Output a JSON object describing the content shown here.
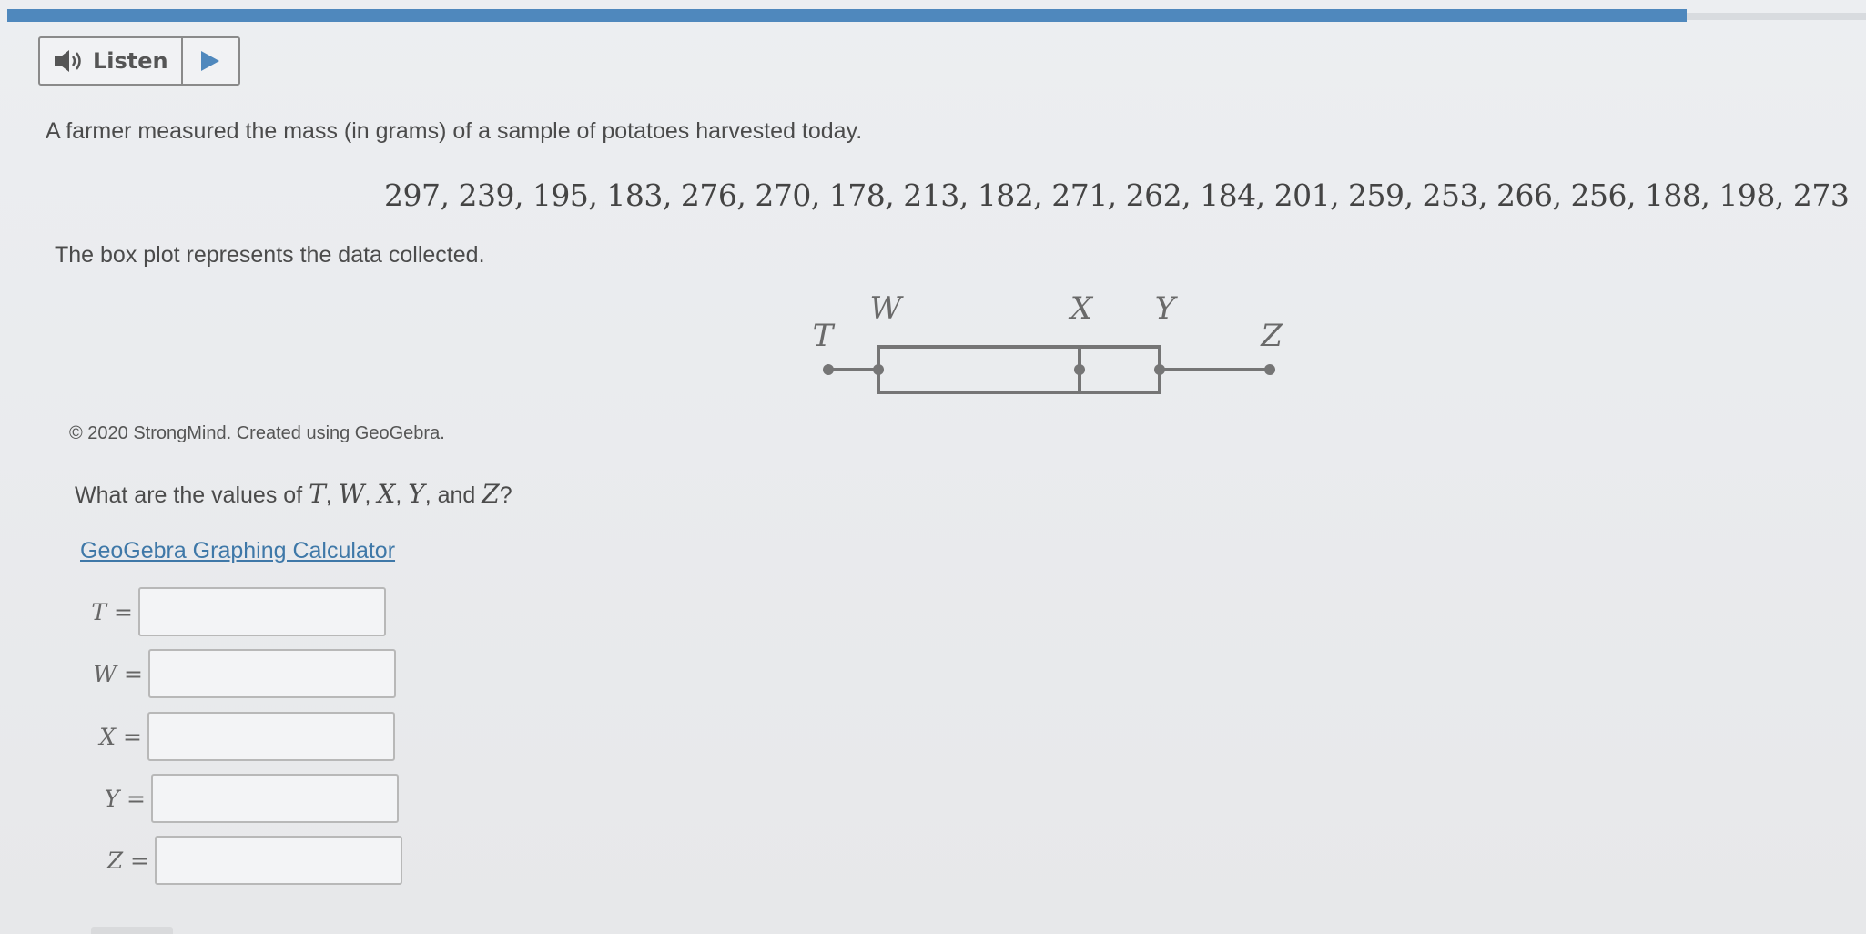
{
  "listen": {
    "label": "Listen"
  },
  "question": {
    "intro": "A farmer measured the mass (in grams) of a sample of potatoes harvested today.",
    "data_values": "297, 239, 195, 183, 276, 270, 178, 213, 182, 271, 262, 184, 201, 259, 253, 266, 256, 188, 198, 273",
    "boxplot_caption": "The box plot represents the data collected.",
    "credit": "© 2020 StrongMind. Created using GeoGebra.",
    "prompt_prefix": "What are the values of",
    "prompt_suffix": "?",
    "calculator_link": "GeoGebra Graphing Calculator"
  },
  "boxplot": {
    "labels": {
      "T": "T",
      "W": "W",
      "X": "X",
      "Y": "Y",
      "Z": "Z"
    }
  },
  "answers": [
    {
      "label": "T",
      "value": ""
    },
    {
      "label": "W",
      "value": ""
    },
    {
      "label": "X",
      "value": ""
    },
    {
      "label": "Y",
      "value": ""
    },
    {
      "label": "Z",
      "value": ""
    }
  ],
  "colors": {
    "topbar": "#4f88bd",
    "link": "#3f78a8",
    "plot_stroke": "#757575"
  },
  "icons": {
    "listen": "speaker-icon",
    "play": "play-icon"
  }
}
